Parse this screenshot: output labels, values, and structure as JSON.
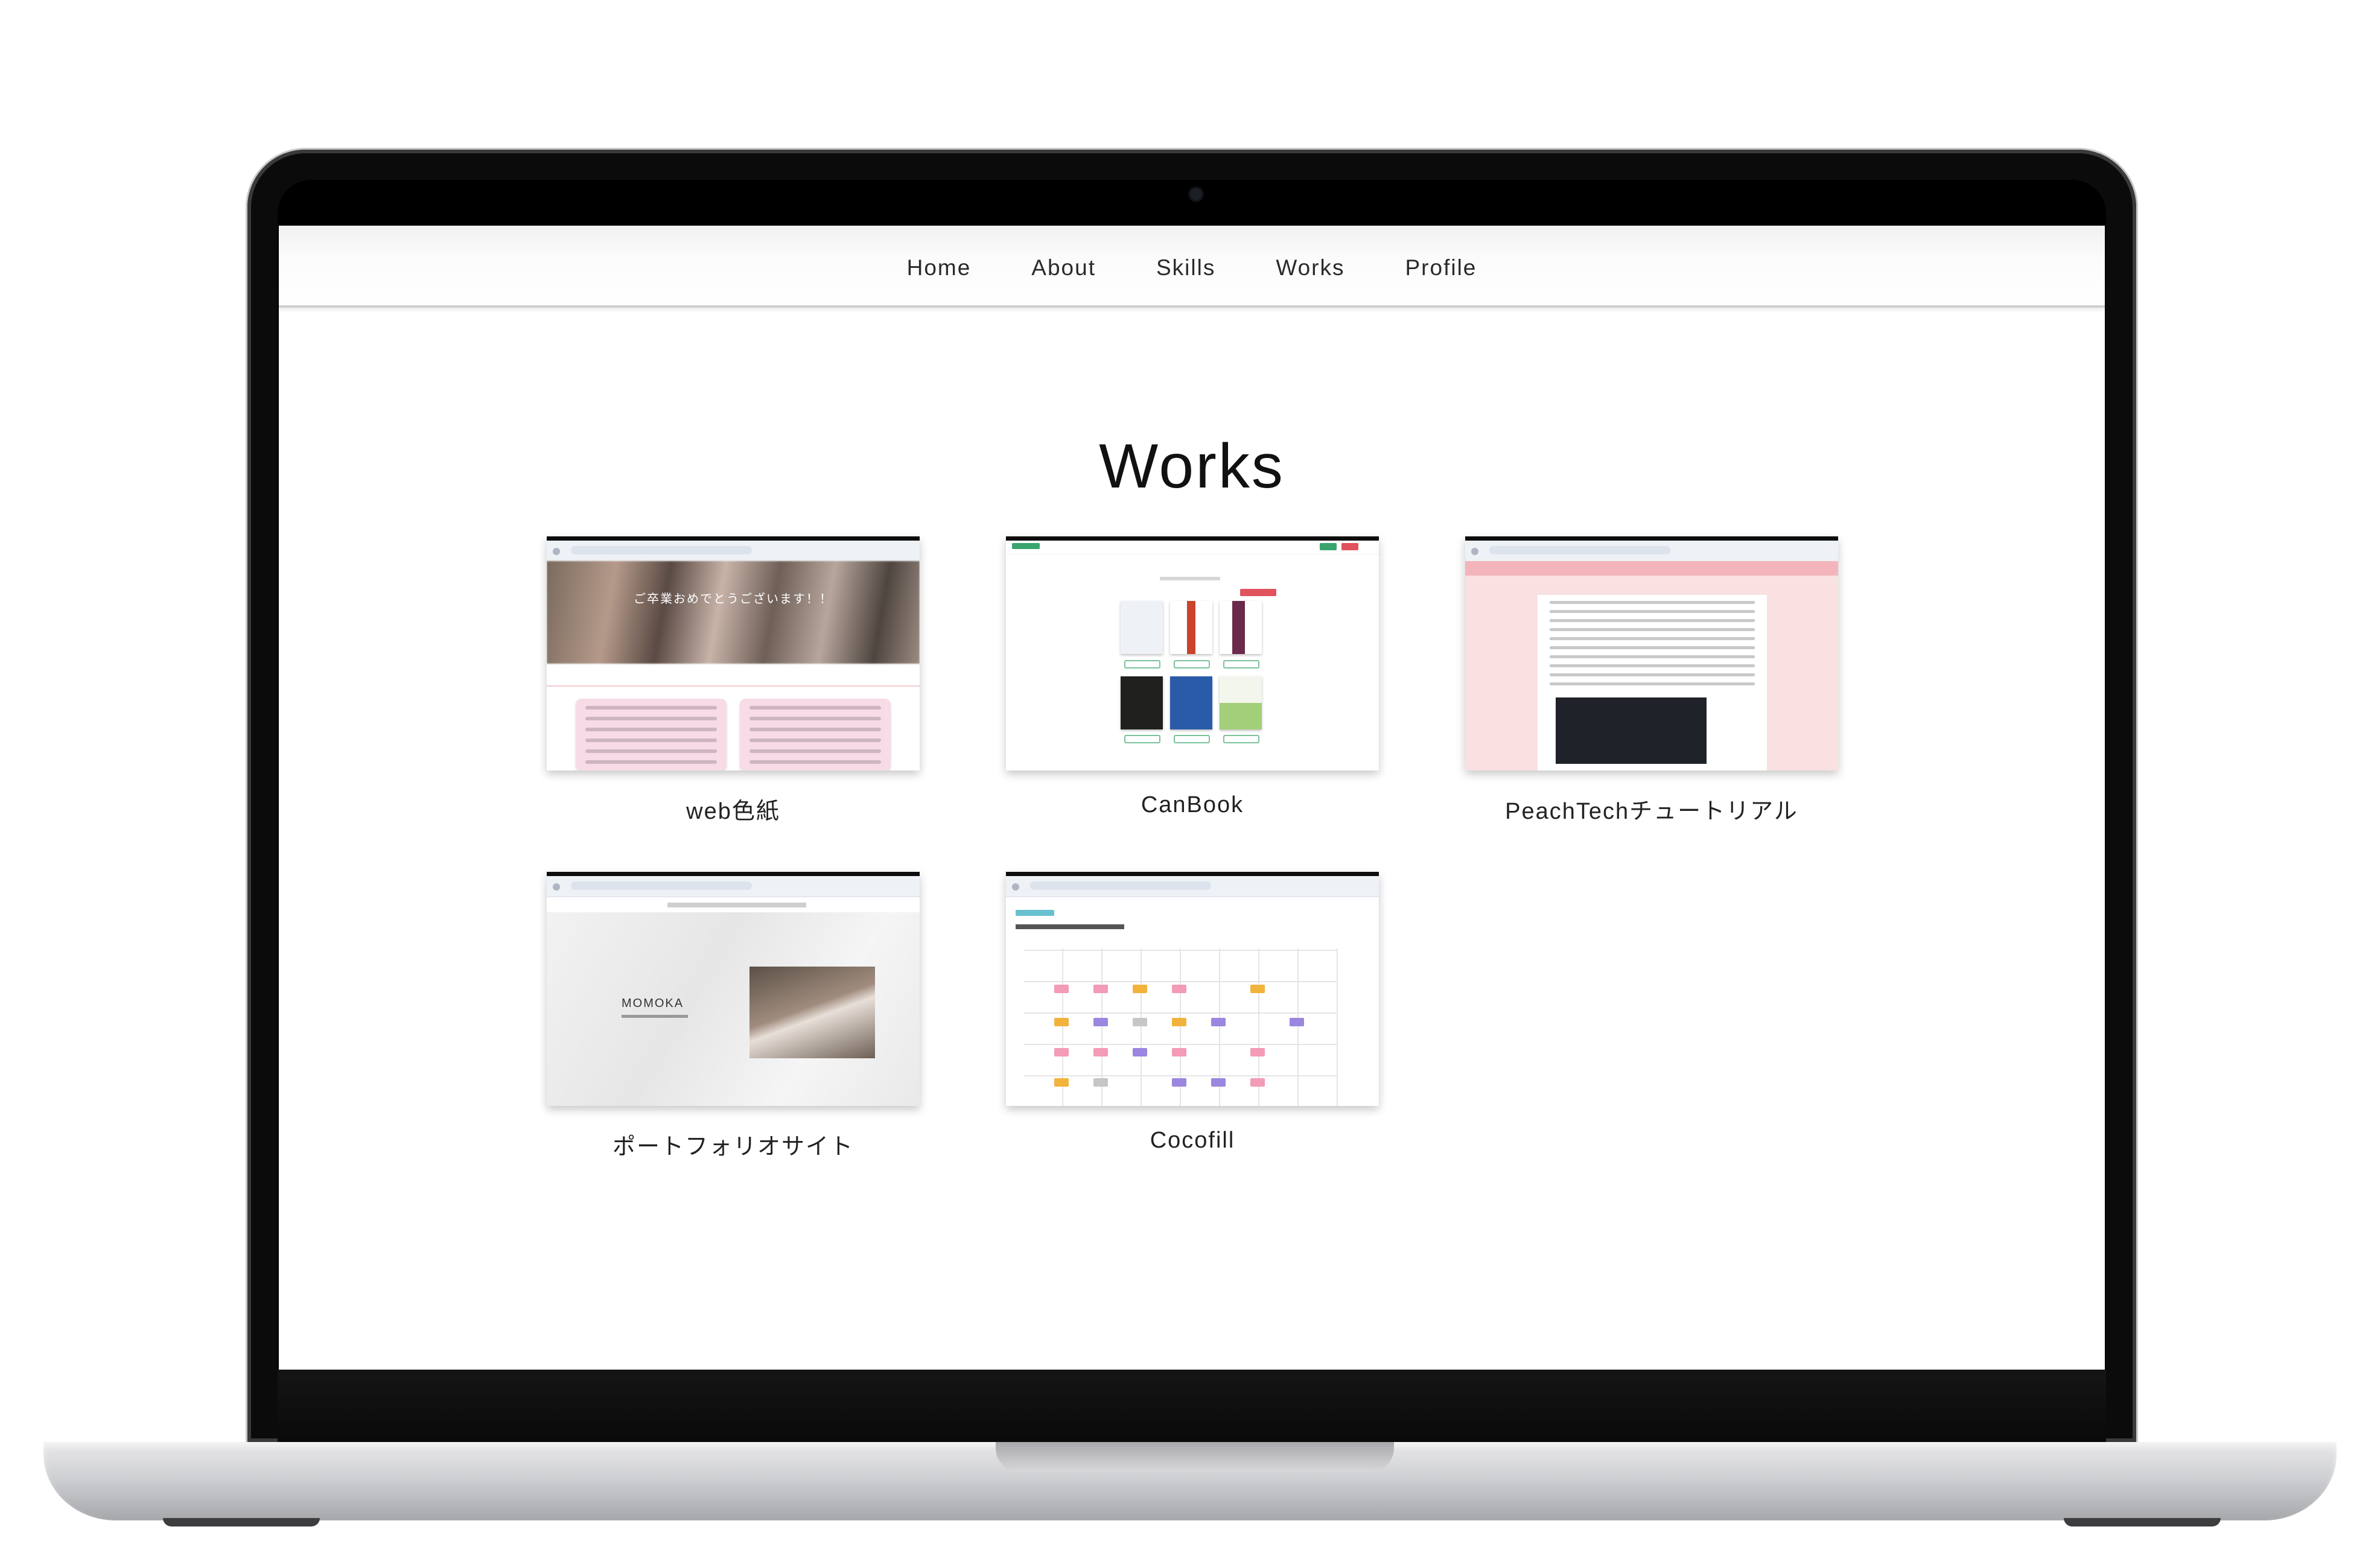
{
  "nav": {
    "items": [
      "Home",
      "About",
      "Skills",
      "Works",
      "Profile"
    ]
  },
  "page": {
    "title": "Works"
  },
  "works": [
    {
      "caption": "web色紙",
      "thumb_text": "ご卒業おめでとうございます！！"
    },
    {
      "caption": "CanBook"
    },
    {
      "caption": "PeachTechチュートリアル"
    },
    {
      "caption": "ポートフォリオサイト",
      "thumb_text": "MOMOKA"
    },
    {
      "caption": "Cocofill"
    }
  ],
  "colors": {
    "screen_background": "#ffffff",
    "nav_text": "#2a2a2a",
    "title_text": "#111111",
    "canbook_accent": "#3aa46e",
    "peachtech_band": "#f3b5bb",
    "cocofill_accent": "#67c0cf"
  }
}
